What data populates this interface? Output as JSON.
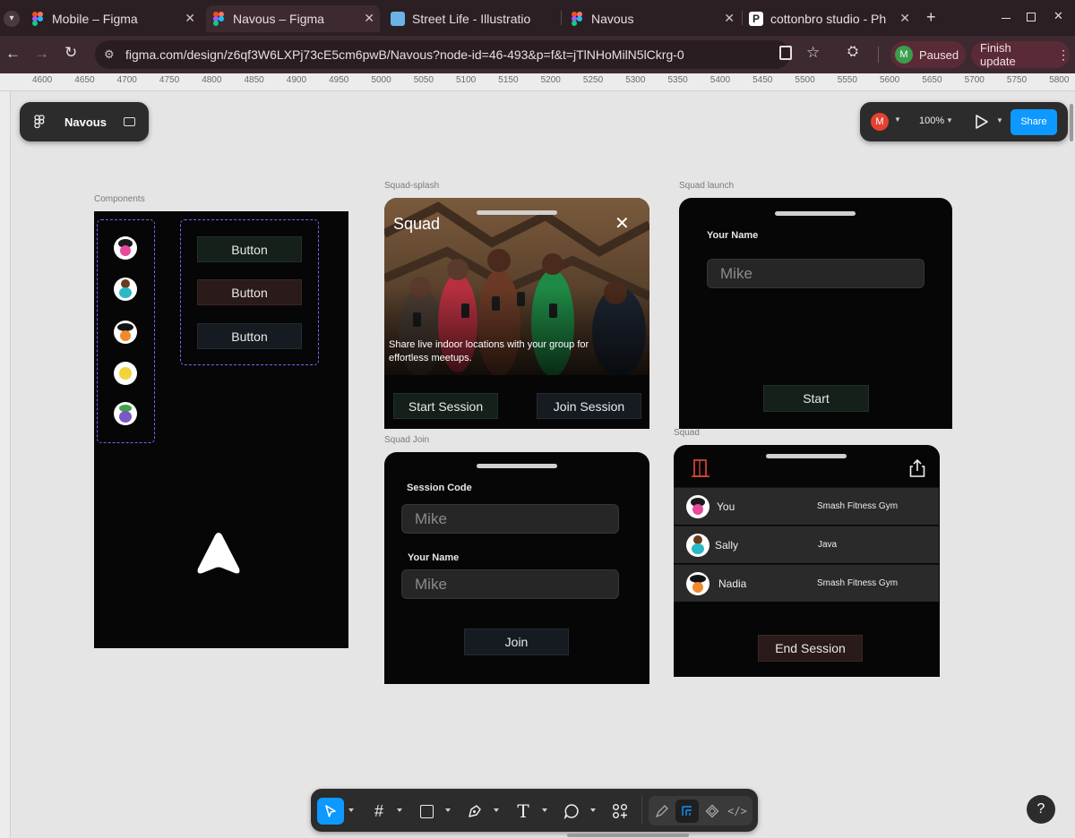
{
  "browser": {
    "tabs": [
      {
        "title": "Mobile – Figma",
        "icon": "figma-icon"
      },
      {
        "title": "Navous – Figma",
        "icon": "figma-icon"
      },
      {
        "title": "Street Life - Illustratio",
        "icon": "street-life-icon"
      },
      {
        "title": "Navous",
        "icon": "figma-icon"
      },
      {
        "title": "cottonbro studio - Ph",
        "icon": "pexels-icon"
      }
    ],
    "url": "figma.com/design/z6qf3W6LXPj73cE5cm6pwB/Navous?node-id=46-493&p=f&t=jTlNHoMilN5lCkrg-0",
    "profile_initial": "M",
    "profile_status": "Paused",
    "update_label": "Finish update"
  },
  "ruler": {
    "labels": [
      "4600",
      "4650",
      "4700",
      "4750",
      "4800",
      "4850",
      "4900",
      "4950",
      "5000",
      "5050",
      "5100",
      "5150",
      "5200",
      "5250",
      "5300",
      "5350",
      "5400",
      "5450",
      "5500",
      "5550",
      "5600",
      "5650",
      "5700",
      "5750",
      "5800"
    ]
  },
  "figma": {
    "file_name": "Navous",
    "user_initial": "M",
    "zoom": "100%",
    "share_label": "Share",
    "accent": "#0d99ff",
    "help": "?"
  },
  "frames": {
    "components": {
      "label": "Components",
      "buttons": [
        "Button",
        "Button",
        "Button"
      ]
    },
    "splash": {
      "label": "Squad-splash",
      "title": "Squad",
      "tagline": "Share live indoor locations with your group for effortless meetups.",
      "start_label": "Start Session",
      "join_label": "Join Session"
    },
    "launch": {
      "label": "Squad launch",
      "name_label": "Your Name",
      "name_value": "Mike",
      "start_label": "Start"
    },
    "join": {
      "label": "Squad Join",
      "code_label": "Session Code",
      "code_value": "Mike",
      "name_label": "Your Name",
      "name_value": "Mike",
      "join_label": "Join"
    },
    "squad": {
      "label": "Squad",
      "members": [
        {
          "name": "You",
          "location": "Smash Fitness Gym"
        },
        {
          "name": "Sally",
          "location": "Java"
        },
        {
          "name": "Nadia",
          "location": "Smash Fitness Gym"
        }
      ],
      "end_label": "End Session",
      "exit_color": "#e8493f"
    }
  }
}
